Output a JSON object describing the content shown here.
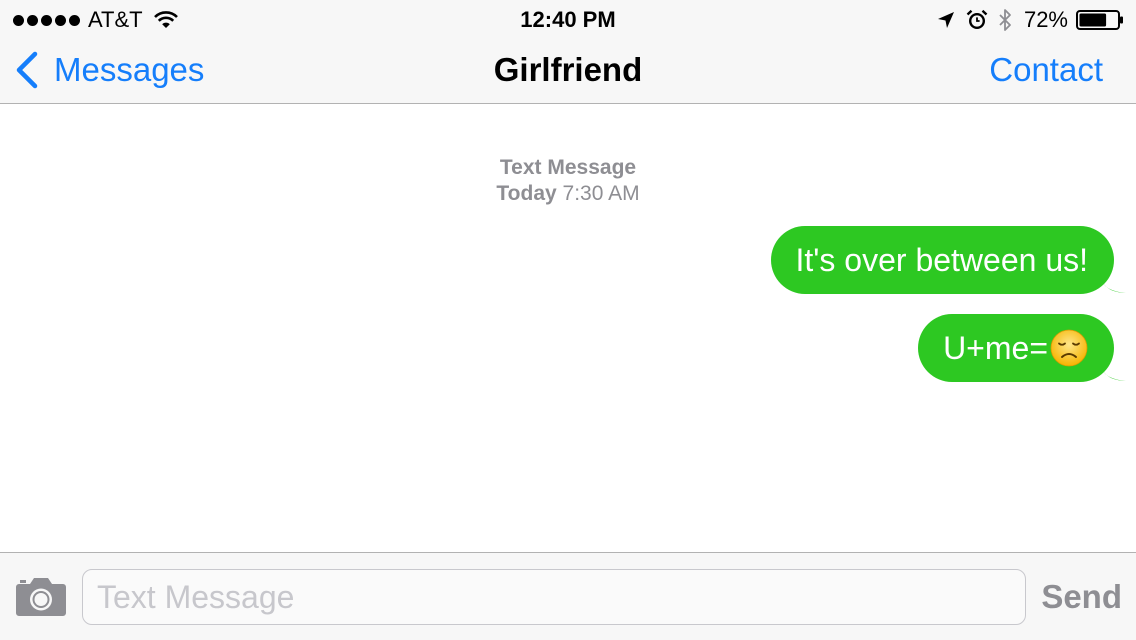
{
  "status_bar": {
    "carrier": "AT&T",
    "time": "12:40 PM",
    "battery_percent": "72%",
    "battery_level": 0.72,
    "signal_bars": 5,
    "icons": [
      "signal-dots",
      "wifi-icon",
      "location-icon",
      "alarm-icon",
      "bluetooth-icon",
      "battery-icon"
    ]
  },
  "nav": {
    "back_label": "Messages",
    "title": "Girlfriend",
    "right_label": "Contact"
  },
  "conversation": {
    "timestamp": {
      "type_label": "Text Message",
      "day": "Today",
      "time": "7:30 AM"
    },
    "messages": [
      {
        "text": "It's over between us!",
        "direction": "outgoing"
      },
      {
        "text": "U+me=",
        "emoji": "disappointed-face",
        "direction": "outgoing"
      }
    ]
  },
  "input": {
    "placeholder": "Text Message",
    "value": "",
    "send_label": "Send"
  },
  "colors": {
    "accent": "#157efb",
    "bubble_green": "#2dc822",
    "muted_gray": "#8e8e93",
    "bar_background": "#f7f7f7"
  }
}
